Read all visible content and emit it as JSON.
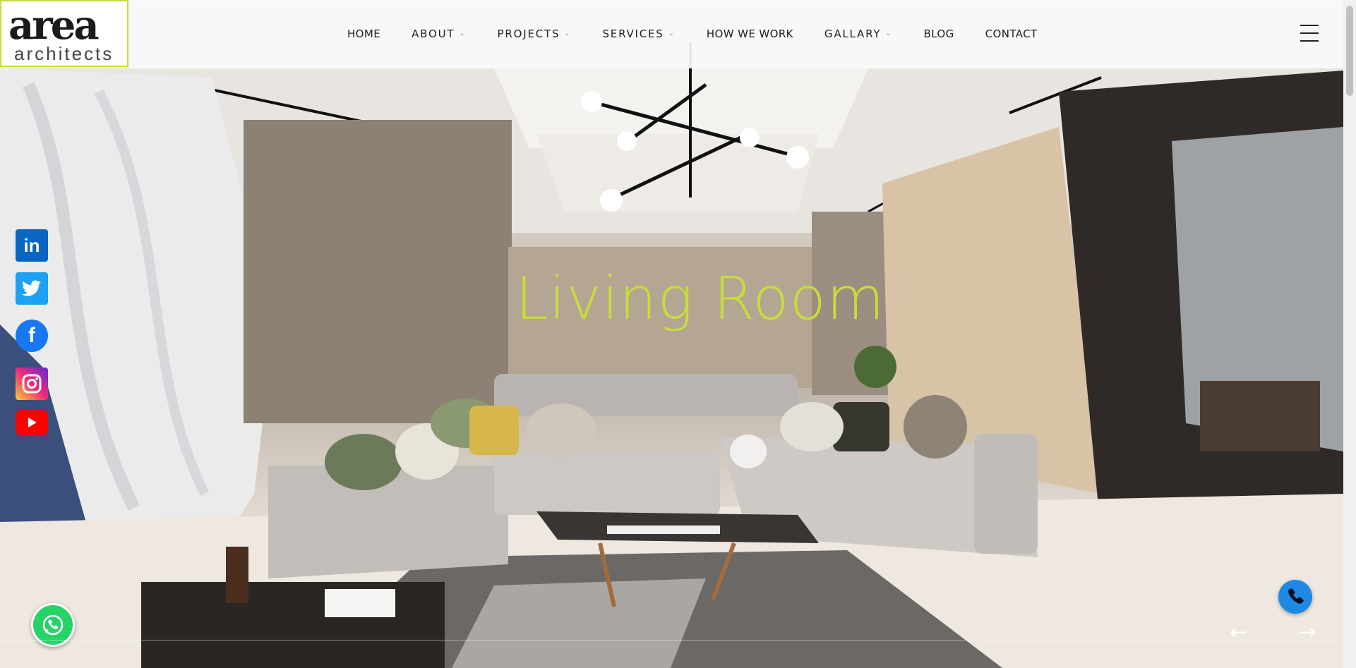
{
  "logo": {
    "main": "area",
    "sub": "architects"
  },
  "nav": {
    "items": [
      {
        "label": "HOME",
        "dropdown": false
      },
      {
        "label": "ABOUT",
        "dropdown": true
      },
      {
        "label": "PROJECTS",
        "dropdown": true
      },
      {
        "label": "SERVICES",
        "dropdown": true
      },
      {
        "label": "HOW WE WORK",
        "dropdown": false
      },
      {
        "label": "GALLARY",
        "dropdown": true
      },
      {
        "label": "BLOG",
        "dropdown": false
      },
      {
        "label": "CONTACT",
        "dropdown": false
      }
    ],
    "chevron": "⌄",
    "menu_icon": "hamburger-icon"
  },
  "hero": {
    "title": "Living Room"
  },
  "social": {
    "linkedin": "in",
    "twitter": "🐦",
    "facebook": "f"
  },
  "slider": {
    "prev": "←",
    "next": "→"
  },
  "colors": {
    "accent": "#c8dc3c",
    "whatsapp": "#25d366",
    "phone": "#1e88e5"
  }
}
